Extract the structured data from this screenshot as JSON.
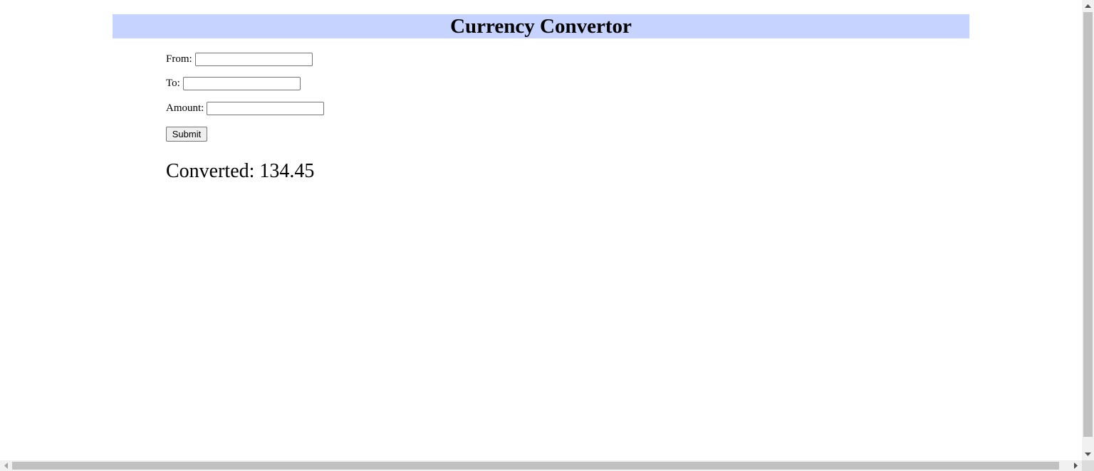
{
  "header": {
    "title": "Currency Convertor",
    "background_color": "#c5d3fe"
  },
  "form": {
    "from": {
      "label": "From:",
      "value": ""
    },
    "to": {
      "label": "To:",
      "value": ""
    },
    "amount": {
      "label": "Amount:",
      "value": ""
    },
    "submit_label": "Submit"
  },
  "result": {
    "text": "Converted: 134.45"
  },
  "scrollbars": {
    "vertical": {
      "up_icon": "arrow-up-icon",
      "down_icon": "arrow-down-icon"
    },
    "horizontal": {
      "left_icon": "arrow-left-icon",
      "right_icon": "arrow-right-icon"
    }
  }
}
